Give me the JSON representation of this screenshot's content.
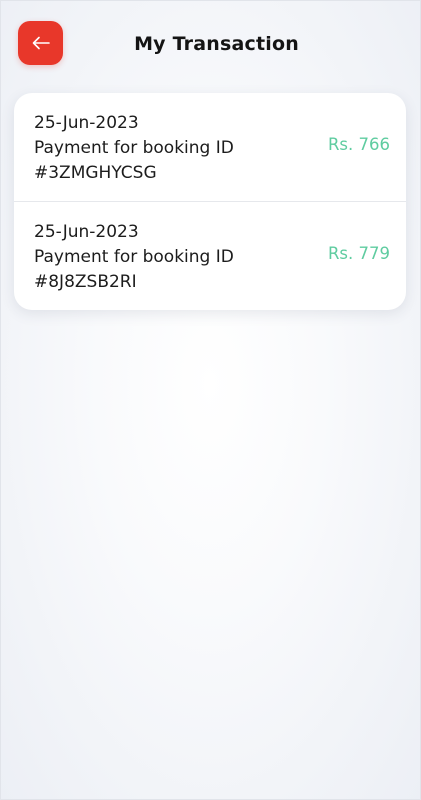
{
  "header": {
    "title": "My Transaction",
    "back_icon": "arrow-left-icon",
    "accent_color": "#e8372a"
  },
  "transactions": [
    {
      "date": "25-Jun-2023",
      "description": "Payment for booking ID",
      "booking_id": "#3ZMGHYCSG",
      "amount": "Rs. 766"
    },
    {
      "date": "25-Jun-2023",
      "description": "Payment for booking ID",
      "booking_id": "#8J8ZSB2RI",
      "amount": "Rs. 779"
    }
  ],
  "colors": {
    "amount": "#5fcca0"
  }
}
